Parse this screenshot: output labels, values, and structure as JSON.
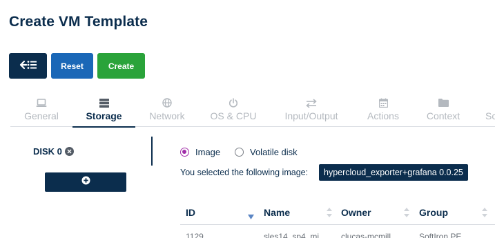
{
  "page": {
    "title": "Create VM Template"
  },
  "toolbar": {
    "back_icon": "back-list-icon",
    "reset_label": "Reset",
    "create_label": "Create"
  },
  "tabs": [
    {
      "label": "General",
      "icon": "laptop-icon",
      "active": false
    },
    {
      "label": "Storage",
      "icon": "storage-icon",
      "active": true
    },
    {
      "label": "Network",
      "icon": "globe-icon",
      "active": false
    },
    {
      "label": "OS & CPU",
      "icon": "power-icon",
      "active": false
    },
    {
      "label": "Input/Output",
      "icon": "exchange-icon",
      "active": false
    },
    {
      "label": "Actions",
      "icon": "calendar-icon",
      "active": false
    },
    {
      "label": "Context",
      "icon": "folder-icon",
      "active": false
    },
    {
      "label": "Sc",
      "icon": "",
      "active": false
    }
  ],
  "disks": {
    "disk_label": "DISK 0",
    "close_icon": "close-circle-icon",
    "add_icon": "plus-circle-icon"
  },
  "source": {
    "image_label": "Image",
    "volatile_label": "Volatile disk",
    "selected": "Image",
    "selected_text": "You selected the following image:",
    "selected_image": "hypercloud_exporter+grafana 0.0.25"
  },
  "table": {
    "columns": [
      "ID",
      "Name",
      "Owner",
      "Group"
    ],
    "rows": [
      [
        "1129",
        "sles14_sp4_mi...",
        "clucas-mcmill...",
        "SoftIron PE"
      ]
    ]
  },
  "colors": {
    "navy": "#0b2d4d",
    "blue": "#1a67b7",
    "green": "#2aa33a",
    "radio_accent": "#a02da8"
  }
}
